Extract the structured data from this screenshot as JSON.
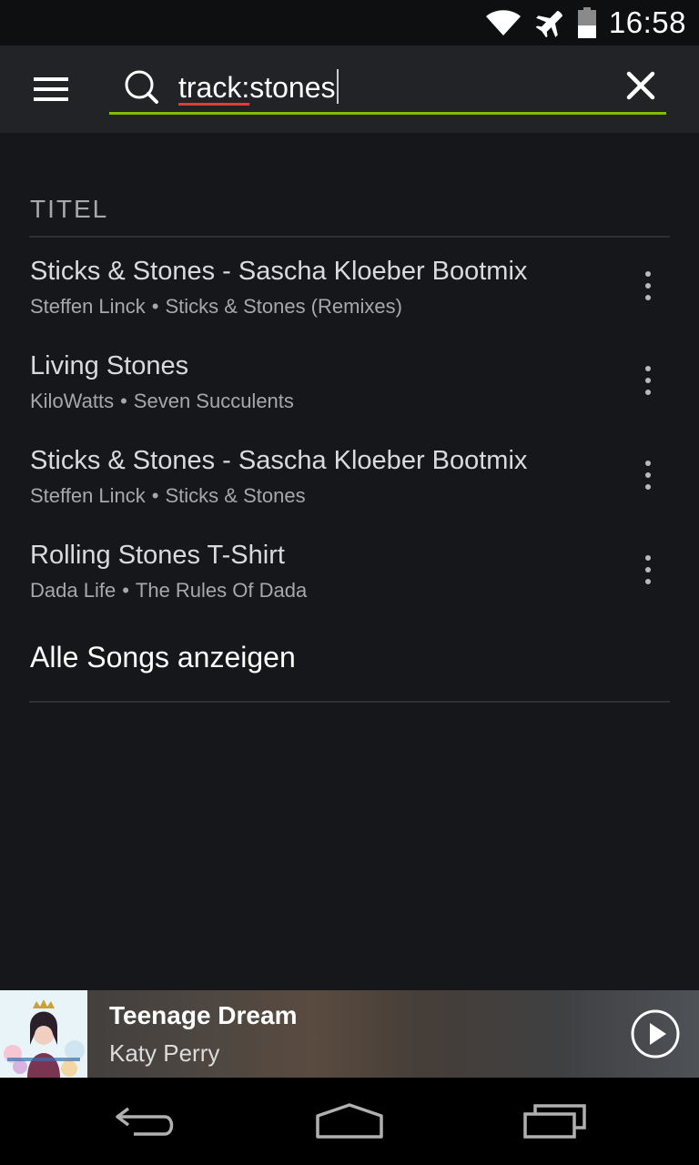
{
  "status_bar": {
    "time": "16:58"
  },
  "search": {
    "prefix": "track:",
    "term": "stones"
  },
  "results": {
    "section_title": "TITEL",
    "tracks": [
      {
        "title": "Sticks & Stones - Sascha Kloeber Bootmix",
        "artist": "Steffen Linck",
        "album": "Sticks & Stones (Remixes)"
      },
      {
        "title": "Living Stones",
        "artist": "KiloWatts",
        "album": "Seven Succulents"
      },
      {
        "title": "Sticks & Stones - Sascha Kloeber Bootmix",
        "artist": "Steffen Linck",
        "album": "Sticks & Stones"
      },
      {
        "title": "Rolling Stones T-Shirt",
        "artist": "Dada Life",
        "album": "The Rules Of Dada"
      }
    ],
    "separator": "•",
    "show_all_label": "Alle Songs anzeigen"
  },
  "now_playing": {
    "title": "Teenage Dream",
    "artist": "Katy Perry"
  },
  "colors": {
    "accent": "#84bd00",
    "background": "#16171a",
    "app_bar": "#222326"
  },
  "icons": {
    "menu": "hamburger-icon",
    "search": "magnifier-icon",
    "clear": "close-icon",
    "more": "vertical-dots-icon",
    "play": "play-circle-icon",
    "nav_back": "back-icon",
    "nav_home": "home-icon",
    "nav_recents": "recents-icon"
  }
}
